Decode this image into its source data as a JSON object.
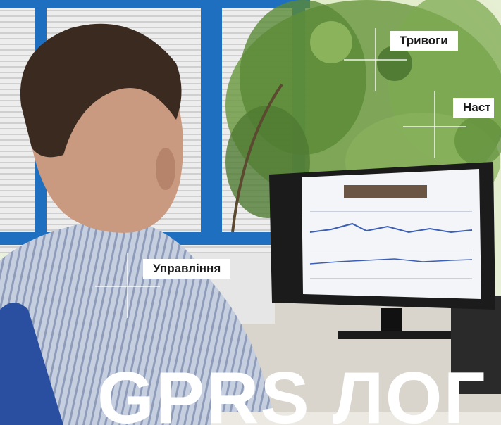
{
  "labels": {
    "alarms": "Тривоги",
    "settings": "Наст",
    "management": "Управління"
  },
  "headline": "GPRS ЛОГ",
  "colors": {
    "window_frame": "#1f6fc0",
    "shirt": "#b9c3d6",
    "hair": "#3a2a20",
    "plant": "#4f7a32",
    "monitor": "#1b1b1b",
    "label_bg": "#ffffff"
  }
}
